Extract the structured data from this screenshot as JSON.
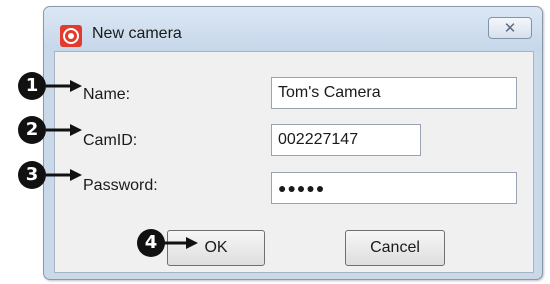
{
  "window": {
    "title": "New camera",
    "close_glyph": "✕",
    "icon": "camera-app-icon"
  },
  "form": {
    "name_label": "Name:",
    "name_value": "Tom's Camera",
    "camid_label": "CamID:",
    "camid_value": "002227147",
    "password_label": "Password:",
    "password_mask": "●●●●●"
  },
  "buttons": {
    "ok_label": "OK",
    "cancel_label": "Cancel"
  },
  "callouts": [
    "1",
    "2",
    "3",
    "4"
  ]
}
